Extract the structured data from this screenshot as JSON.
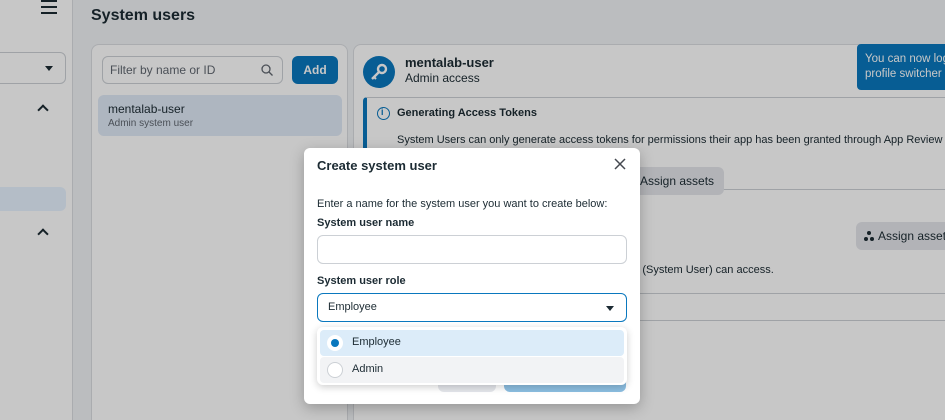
{
  "page": {
    "title": "System users"
  },
  "list": {
    "filter_placeholder": "Filter by name or ID",
    "add_label": "Add",
    "items": [
      {
        "name": "mentalab-user",
        "subtitle": "Admin system user"
      }
    ]
  },
  "detail": {
    "name": "mentalab-user",
    "role": "Admin access",
    "info_title": "Generating Access Tokens",
    "info_text": "System Users can only generate access tokens for permissions their app has been granted through App Review",
    "assign_label": "Assign assets",
    "assign_label_2": "Assign asset",
    "section_text": "ser (System User) can access."
  },
  "toast": {
    "text_line1": "You can now log",
    "text_line2": "profile switcher"
  },
  "modal": {
    "title": "Create system user",
    "description": "Enter a name for the system user you want to create below:",
    "name_label": "System user name",
    "name_value": "",
    "role_label": "System user role",
    "role_selected": "Employee",
    "role_options": [
      {
        "label": "Employee",
        "selected": true
      },
      {
        "label": "Admin",
        "selected": false
      }
    ]
  },
  "colors": {
    "accent": "#0a78be",
    "selected_bg": "#dcecf9"
  }
}
